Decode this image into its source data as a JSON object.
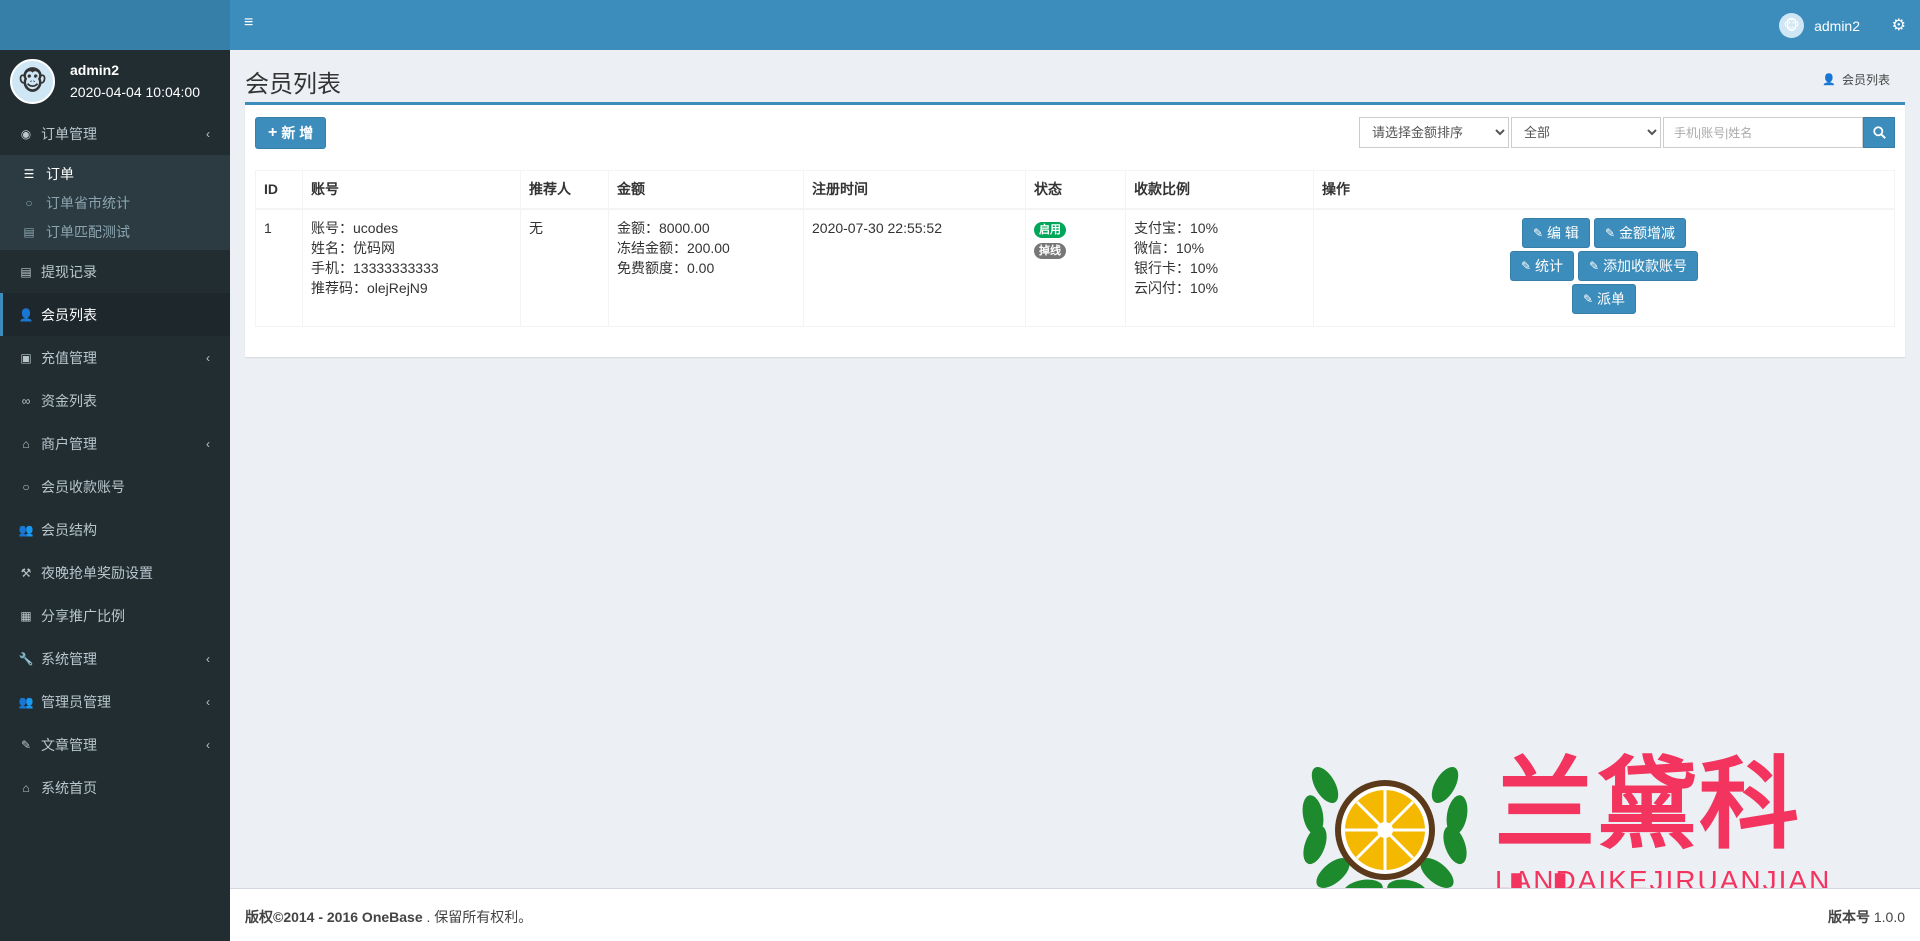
{
  "app": {
    "username": "admin2",
    "login_time": "2020-04-04 10:04:00",
    "avatar_icon": "monkey-avatar"
  },
  "sidebar": {
    "items": [
      {
        "label": "订单管理",
        "icon": "circle-dot-icon",
        "chevron": true
      },
      {
        "label": "提现记录",
        "icon": "list-alt-icon",
        "chevron": false
      },
      {
        "label": "会员列表",
        "icon": "user-icon",
        "chevron": false,
        "active": true
      },
      {
        "label": "充值管理",
        "icon": "image-icon",
        "chevron": true
      },
      {
        "label": "资金列表",
        "icon": "link-icon",
        "chevron": false
      },
      {
        "label": "商户管理",
        "icon": "bank-icon",
        "chevron": true
      },
      {
        "label": "会员收款账号",
        "icon": "circle-icon",
        "chevron": false
      },
      {
        "label": "会员结构",
        "icon": "users-icon",
        "chevron": false
      },
      {
        "label": "夜晚抢单奖励设置",
        "icon": "gavel-icon",
        "chevron": false
      },
      {
        "label": "分享推广比例",
        "icon": "linkedin-icon",
        "chevron": false
      },
      {
        "label": "系统管理",
        "icon": "wrench-icon",
        "chevron": true
      },
      {
        "label": "管理员管理",
        "icon": "users-icon",
        "chevron": true
      },
      {
        "label": "文章管理",
        "icon": "edit-icon",
        "chevron": true
      },
      {
        "label": "系统首页",
        "icon": "home-icon",
        "chevron": false
      }
    ],
    "submenu": [
      {
        "label": "订单"
      },
      {
        "label": "订单省市统计"
      },
      {
        "label": "订单匹配测试"
      }
    ]
  },
  "header": {
    "username": "admin2"
  },
  "content": {
    "title": "会员列表",
    "breadcrumb": "会员列表"
  },
  "toolbar": {
    "add_label": "新 增",
    "sort_placeholder": "请选择金额排序",
    "status_selected": "全部",
    "search_placeholder": "手机|账号|姓名"
  },
  "table": {
    "headers": [
      "ID",
      "账号",
      "推荐人",
      "金额",
      "注册时间",
      "状态",
      "收款比例",
      "操作"
    ],
    "rows": [
      {
        "id": "1",
        "account": "账号：ucodes",
        "name": "姓名：优码网",
        "phone": "手机：13333333333",
        "ref_code": "推荐码：olejRejN9",
        "referrer": "无",
        "amount": "金额：8000.00",
        "frozen": "冻结金额：200.00",
        "free_quota": "免费额度：0.00",
        "reg_time": "2020-07-30 22:55:52",
        "status_enabled": "启用",
        "status_online": "掉线",
        "rate_alipay": "支付宝：10%",
        "rate_wechat": "微信：10%",
        "rate_bank": "银行卡：10%",
        "rate_cloud": "云闪付：10%",
        "actions": {
          "edit": "编 辑",
          "adjust": "金额增减",
          "stats": "统计",
          "add_account": "添加收款账号",
          "dispatch": "派单"
        }
      }
    ]
  },
  "footer": {
    "copyright_bold": "版权©2014 - 2016 OneBase",
    "copyright_rest": ". 保留所有权利。",
    "version_label": "版本号",
    "version_value": "1.0.0"
  },
  "watermark": {
    "title": "兰黛科技",
    "subtitle": "LANDAIKEJIRUANJIAN"
  },
  "colors": {
    "primary": "#3c8dbc",
    "sidebar_bg": "#222d32",
    "success": "#00a65a",
    "watermark": "#f2345e"
  }
}
